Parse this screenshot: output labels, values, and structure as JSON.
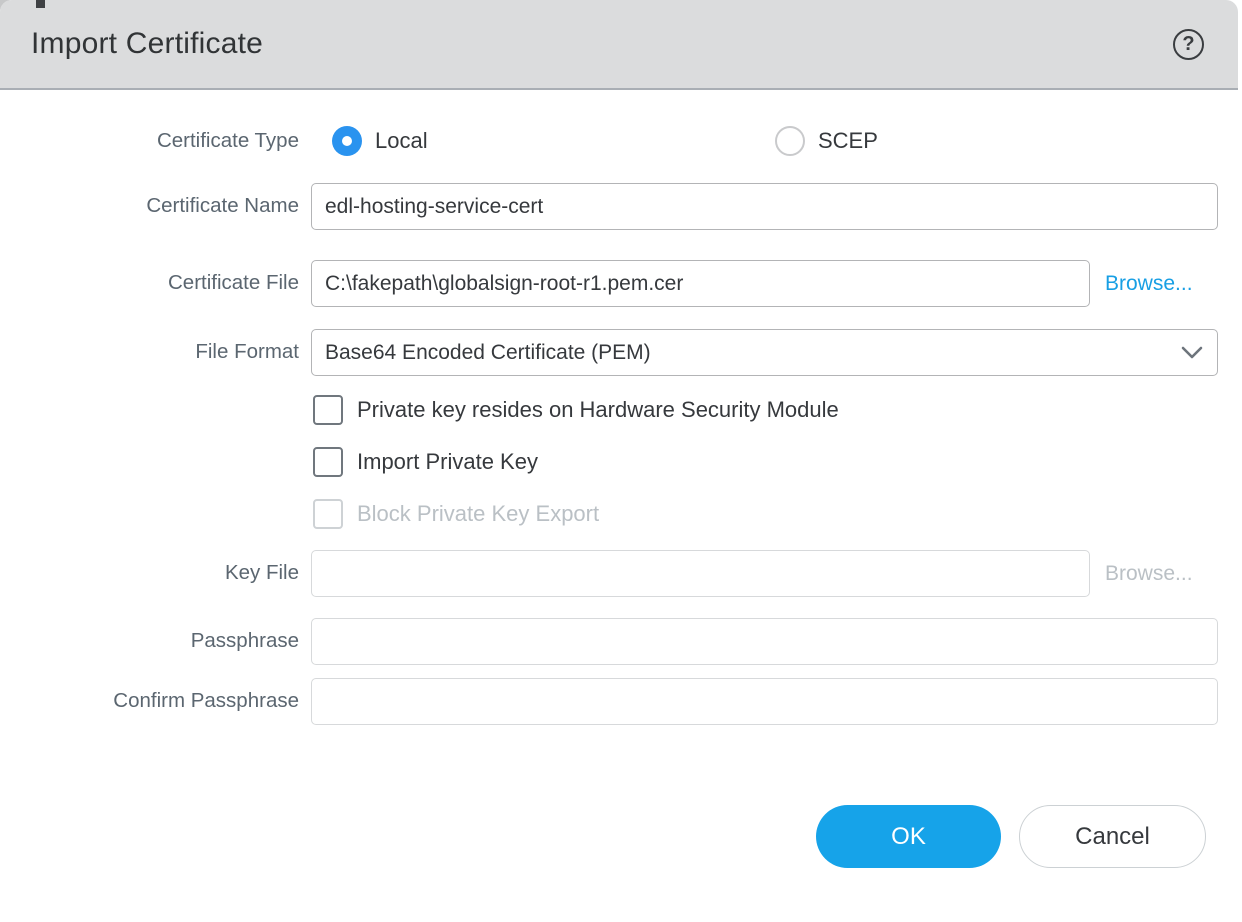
{
  "dialog": {
    "title": "Import Certificate",
    "help_label": "?",
    "certificate_type": {
      "label": "Certificate Type",
      "options": [
        {
          "label": "Local",
          "selected": true
        },
        {
          "label": "SCEP",
          "selected": false
        }
      ]
    },
    "certificate_name": {
      "label": "Certificate Name",
      "value": "edl-hosting-service-cert"
    },
    "certificate_file": {
      "label": "Certificate File",
      "value": "C:\\fakepath\\globalsign-root-r1.pem.cer",
      "browse_label": "Browse..."
    },
    "file_format": {
      "label": "File Format",
      "selected_option": "Base64 Encoded Certificate (PEM)"
    },
    "checkboxes": [
      {
        "label": "Private key resides on Hardware Security Module",
        "checked": false,
        "disabled": false
      },
      {
        "label": "Import Private Key",
        "checked": false,
        "disabled": false
      },
      {
        "label": "Block Private Key Export",
        "checked": false,
        "disabled": true
      }
    ],
    "key_file": {
      "label": "Key File",
      "value": "",
      "browse_label": "Browse...",
      "disabled": true
    },
    "passphrase": {
      "label": "Passphrase",
      "value": "",
      "disabled": true
    },
    "confirm_passphrase": {
      "label": "Confirm Passphrase",
      "value": "",
      "disabled": true
    },
    "buttons": {
      "ok": "OK",
      "cancel": "Cancel"
    },
    "colors": {
      "accent_blue": "#16a3e9",
      "radio_blue": "#2a93ef",
      "link_blue": "#189fe4",
      "header_bg": "#dbdcdd",
      "label_gray": "#5b6670",
      "disabled_gray": "#bac0c5"
    }
  }
}
